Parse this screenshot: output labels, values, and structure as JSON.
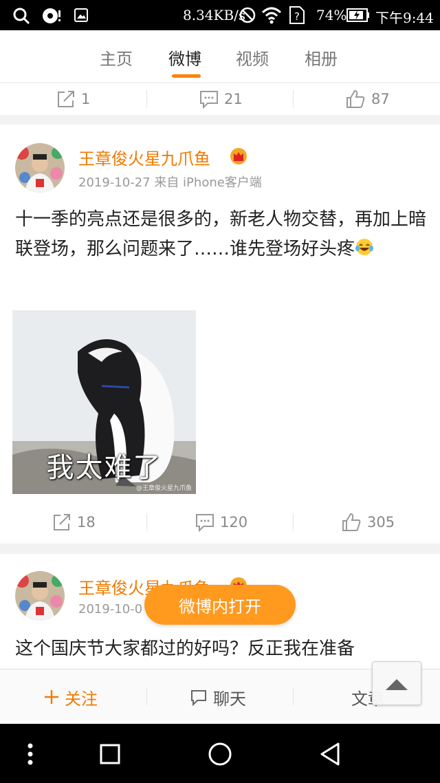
{
  "status_bar": {
    "speed": "8.34KB/s",
    "battery": "74%",
    "time": "下午9:44"
  },
  "tabs": [
    {
      "label": "主页"
    },
    {
      "label": "微博"
    },
    {
      "label": "视频"
    },
    {
      "label": "相册"
    }
  ],
  "active_tab": "微博",
  "colors": {
    "accent": "#ff8200",
    "username": "#f27a00",
    "open_button": "#ff9a1e"
  },
  "top_actions": {
    "repost": "1",
    "comment": "21",
    "like": "87"
  },
  "post1": {
    "username": "王章俊火星九爪鱼",
    "meta": "2019-10-27 来自 iPhone客户端",
    "text": "十一季的亮点还是很多的，新老人物交替，再加上暗联登场，那么问题来了……谁先登场好头疼",
    "emoji": "laughing-tears-emoji",
    "image_caption": "我太难了",
    "image_watermark": "@王章俊火星九爪鱼",
    "repost": "18",
    "comment": "120",
    "like": "305"
  },
  "post2": {
    "username": "王章俊火星九爪鱼",
    "meta": "2019-10-0",
    "text": "这个国庆节大家都过的好吗？反正我在准备"
  },
  "open_in_app": "微博内打开",
  "bottom_bar": {
    "follow": "关注",
    "chat": "聊天",
    "article": "文章"
  }
}
